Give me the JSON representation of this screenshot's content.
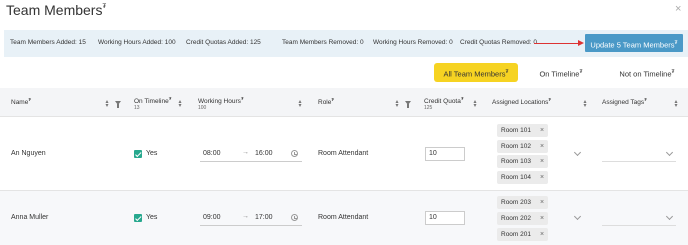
{
  "header": {
    "title": "Team Members",
    "title_marker": "₮",
    "close_label": "×"
  },
  "summary": {
    "members_added": "Team Members Added: 15",
    "hours_added": "Working Hours Added: 100",
    "quotas_added": "Credit Quotas Added: 125",
    "members_removed": "Team Members Removed: 0",
    "hours_removed": "Working Hours Removed: 0",
    "quotas_removed": "Credit Quotas Removed: 0",
    "update_label": "Update 5 Team Members",
    "update_marker": "₮",
    "arrow_color": "#dd3333"
  },
  "filters": [
    {
      "label": "All Team Members",
      "marker": "₮",
      "active": true
    },
    {
      "label": "On Timeline",
      "marker": "₮",
      "active": false
    },
    {
      "label": "Not on Timeline",
      "marker": "₮",
      "active": false
    }
  ],
  "columns": {
    "name": "Name",
    "name_marker": "₮",
    "on_timeline": "On Timeline",
    "on_timeline_marker": "₮",
    "on_timeline_count": "13",
    "working_hours": "Working Hours",
    "working_hours_marker": "₮",
    "working_hours_count": "100",
    "role": "Role",
    "role_marker": "₮",
    "credit_quota": "Credit Quota",
    "credit_quota_marker": "₮",
    "credit_quota_count": "125",
    "assigned_locations": "Assigned Locations",
    "assigned_locations_marker": "₮",
    "assigned_tags": "Assigned Tags",
    "assigned_tags_marker": "₮"
  },
  "rows": [
    {
      "name": "An Nguyen",
      "on_timeline": "Yes",
      "start": "08:00",
      "arrow": "→",
      "end": "16:00",
      "role": "Room Attendant",
      "quota": "10",
      "locations": [
        "Room 101",
        "Room 102",
        "Room 103",
        "Room 104"
      ]
    },
    {
      "name": "Anna Muller",
      "on_timeline": "Yes",
      "start": "09:00",
      "arrow": "→",
      "end": "17:00",
      "role": "Room Attendant",
      "quota": "10",
      "locations": [
        "Room 203",
        "Room 202",
        "Room 201"
      ]
    }
  ],
  "chip_remove_label": "×",
  "colors": {
    "accent": "#4a99c7",
    "filter_active": "#f6d322",
    "check": "#27a88e",
    "summary_bg": "#e8f1f7"
  }
}
